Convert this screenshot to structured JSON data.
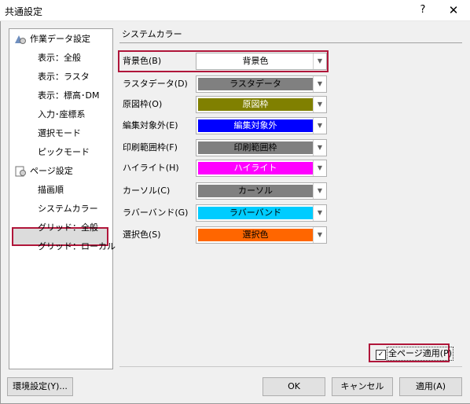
{
  "window": {
    "title": "共通設定",
    "help": "?",
    "close": "✕"
  },
  "tree": {
    "parents": [
      {
        "label": "作業データ設定"
      },
      {
        "label": "ページ設定"
      }
    ],
    "children": [
      {
        "label": "表示：全般"
      },
      {
        "label": "表示：ラスタ"
      },
      {
        "label": "表示：標高･DM"
      },
      {
        "label": "入力･座標系"
      },
      {
        "label": "選択モード"
      },
      {
        "label": "ピックモード"
      },
      {
        "label": "描画順"
      },
      {
        "label": "システムカラー"
      },
      {
        "label": "グリッド：全般"
      },
      {
        "label": "グリッド：ローカル"
      }
    ]
  },
  "section_title": "システムカラー",
  "rows": [
    {
      "label": "背景色(B)",
      "value": "背景色",
      "color": "#ffffff",
      "text_color": "#000000"
    },
    {
      "label": "ラスタデータ(D)",
      "value": "ラスタデータ",
      "color": "#808080",
      "text_color": "#000000"
    },
    {
      "label": "原図枠(O)",
      "value": "原図枠",
      "color": "#808000",
      "text_color": "#ffffff"
    },
    {
      "label": "編集対象外(E)",
      "value": "編集対象外",
      "color": "#0000ff",
      "text_color": "#ffffff"
    },
    {
      "label": "印刷範囲枠(F)",
      "value": "印刷範囲枠",
      "color": "#808080",
      "text_color": "#000000"
    },
    {
      "label": "ハイライト(H)",
      "value": "ハイライト",
      "color": "#ff00ff",
      "text_color": "#ffffff"
    },
    {
      "label": "カーソル(C)",
      "value": "カーソル",
      "color": "#808080",
      "text_color": "#000000"
    },
    {
      "label": "ラバーバンド(G)",
      "value": "ラバーバンド",
      "color": "#00ccff",
      "text_color": "#000000"
    },
    {
      "label": "選択色(S)",
      "value": "選択色",
      "color": "#ff6600",
      "text_color": "#000000"
    }
  ],
  "apply_all": {
    "label": "全ページ適用(P)",
    "checked": true
  },
  "buttons": {
    "env": "環境設定(Y)...",
    "ok": "OK",
    "cancel": "キャンセル",
    "apply": "適用(A)"
  }
}
